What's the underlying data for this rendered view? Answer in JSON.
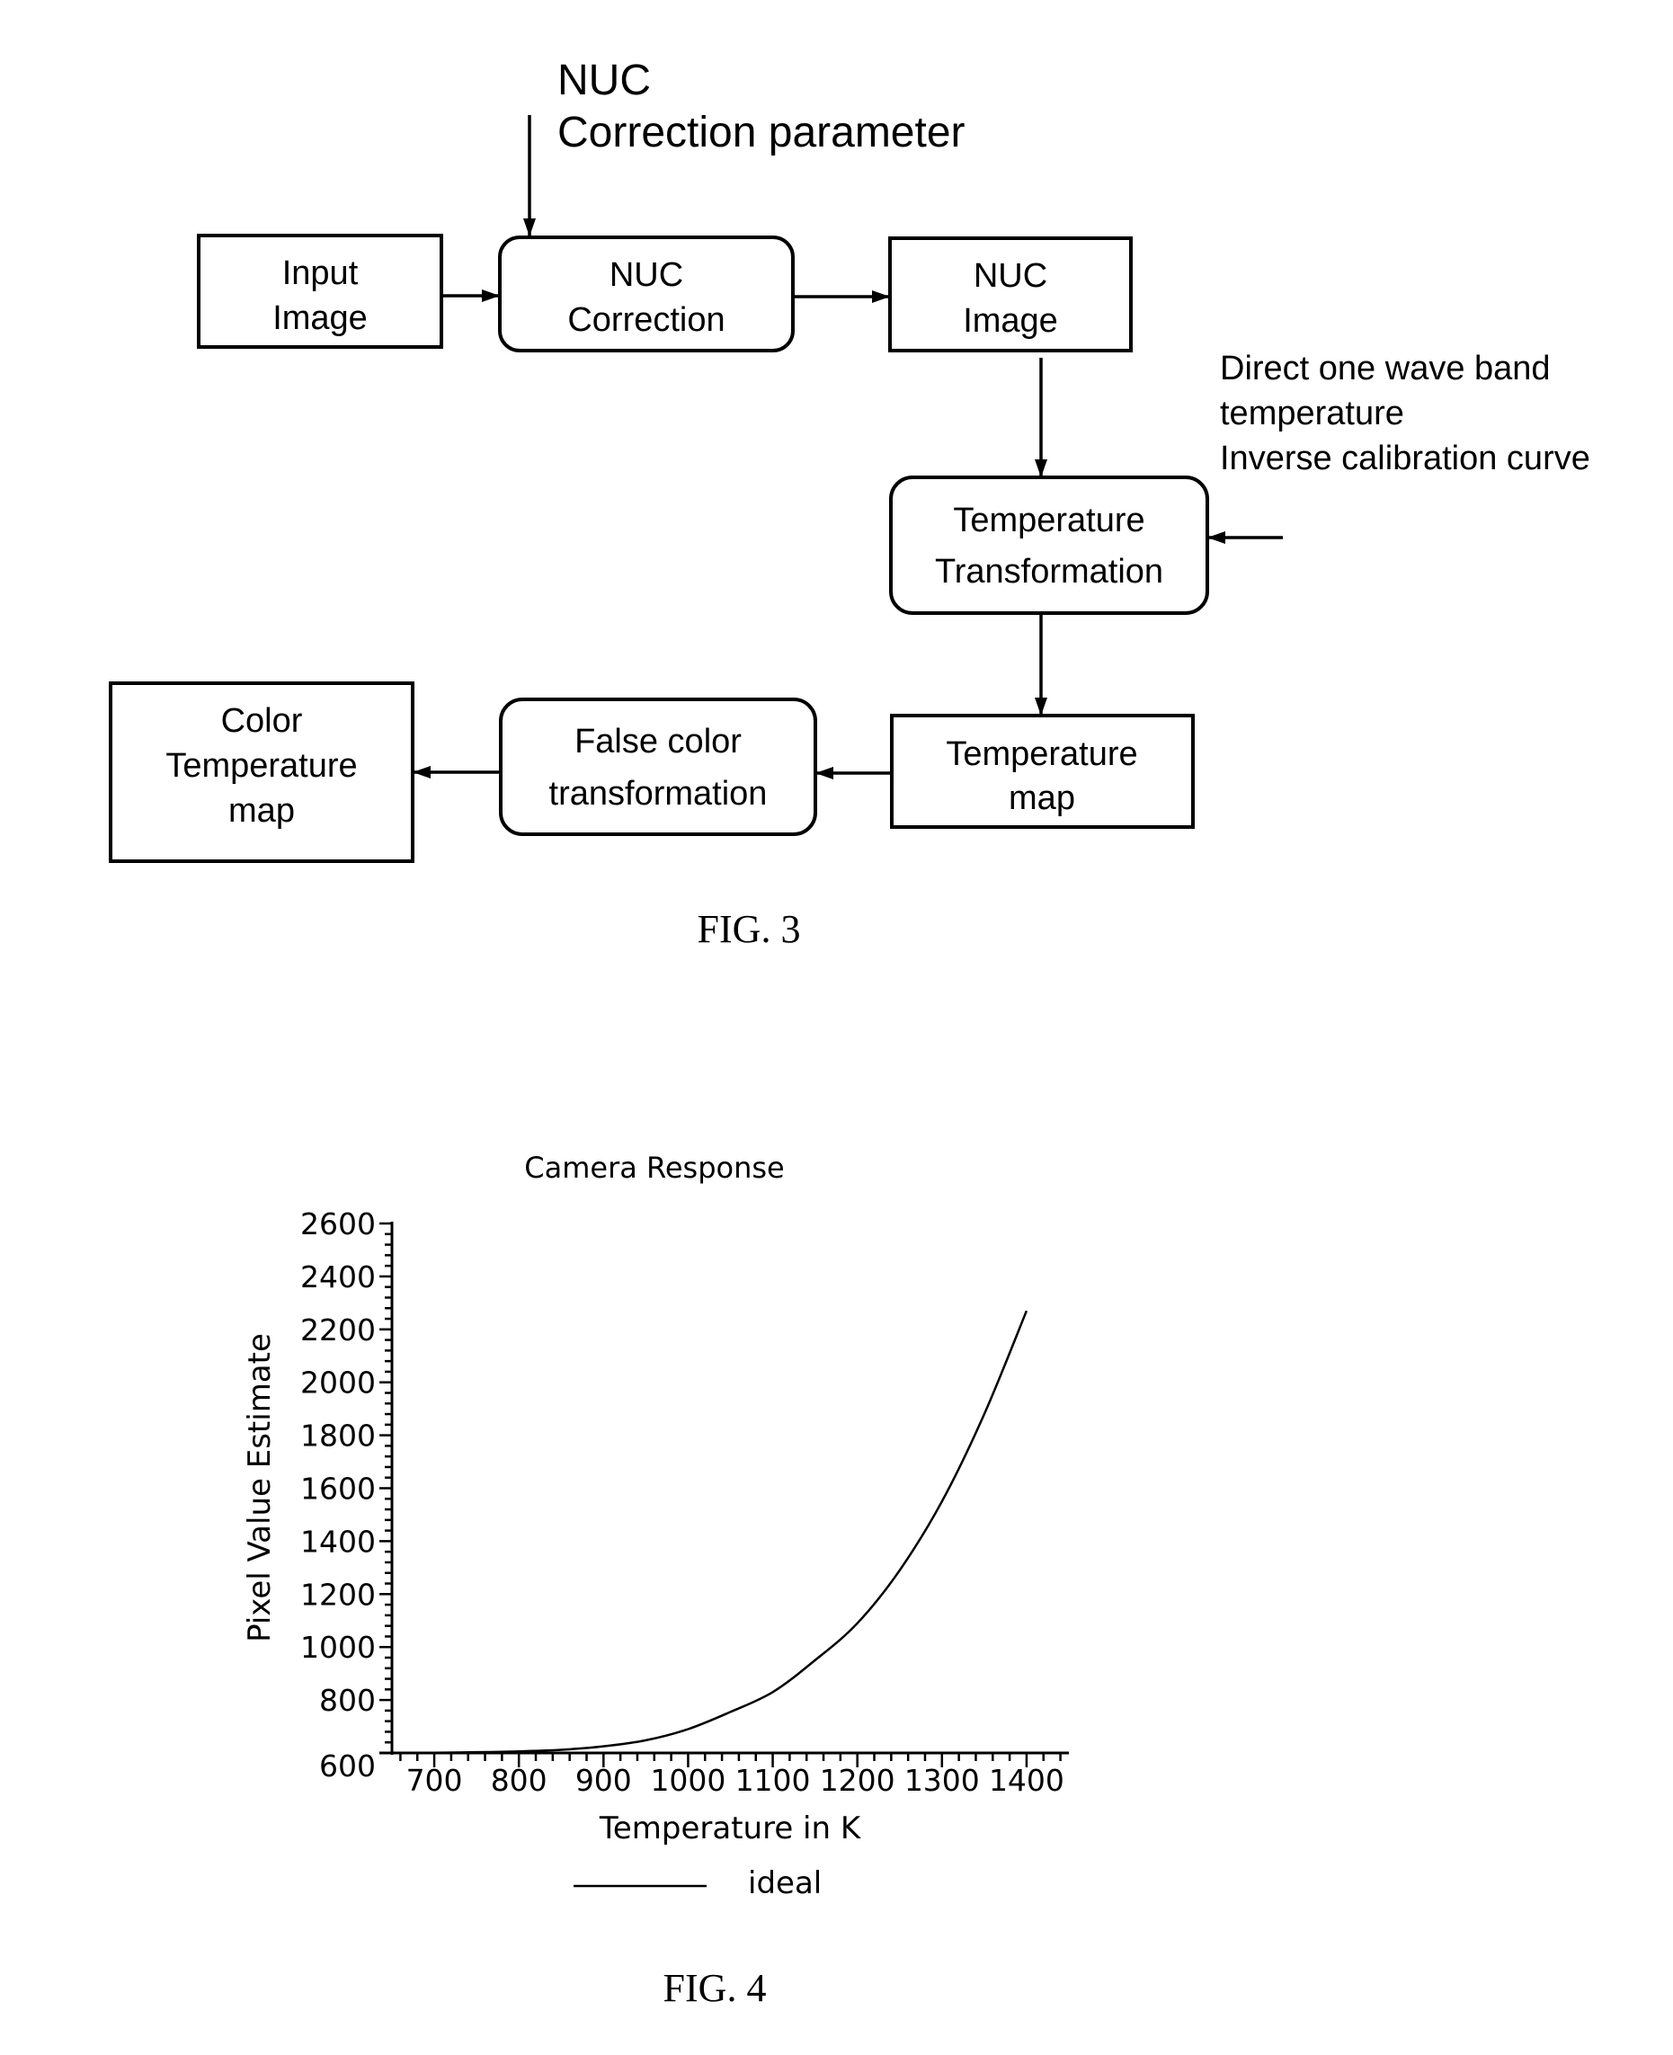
{
  "fig3": {
    "caption": "FIG. 3",
    "top_label": [
      "NUC",
      "Correction parameter"
    ],
    "side_label": [
      "Direct one wave band",
      "temperature",
      "Inverse calibration curve"
    ],
    "nodes": [
      {
        "id": "input_image",
        "shape": "rect",
        "lines": [
          "Input",
          "Image"
        ]
      },
      {
        "id": "nuc_correction",
        "shape": "rounded",
        "lines": [
          "NUC",
          "Correction"
        ]
      },
      {
        "id": "nuc_image",
        "shape": "rect",
        "lines": [
          "NUC",
          "Image"
        ]
      },
      {
        "id": "temperature_transformation",
        "shape": "rounded",
        "lines": [
          "Temperature",
          "Transformation"
        ]
      },
      {
        "id": "temperature_map",
        "shape": "rect",
        "lines": [
          "Temperature",
          "map"
        ]
      },
      {
        "id": "false_color_transformation",
        "shape": "rounded",
        "lines": [
          "False color",
          "transformation"
        ]
      },
      {
        "id": "color_temperature_map",
        "shape": "rect",
        "lines": [
          "Color",
          "Temperature",
          "map"
        ]
      }
    ],
    "edges": [
      {
        "from": "correction_parameter",
        "to": "nuc_correction"
      },
      {
        "from": "input_image",
        "to": "nuc_correction"
      },
      {
        "from": "nuc_correction",
        "to": "nuc_image"
      },
      {
        "from": "nuc_image",
        "to": "temperature_transformation"
      },
      {
        "from": "inverse_calibration_curve",
        "to": "temperature_transformation"
      },
      {
        "from": "temperature_transformation",
        "to": "temperature_map"
      },
      {
        "from": "temperature_map",
        "to": "false_color_transformation"
      },
      {
        "from": "false_color_transformation",
        "to": "color_temperature_map"
      }
    ]
  },
  "fig4": {
    "caption": "FIG. 4",
    "chart_data": {
      "type": "line",
      "title": "Camera Response",
      "xlabel": "Temperature in K",
      "ylabel": "Pixel Value Estimate",
      "xlim": [
        650,
        1450
      ],
      "ylim": [
        600,
        2600
      ],
      "x_ticks": [
        700,
        800,
        900,
        1000,
        1100,
        1200,
        1300,
        1400
      ],
      "x_tick_labels": [
        "700",
        "800",
        "900",
        "1000",
        "1100",
        "1200",
        "1300",
        "1400"
      ],
      "x_minor_step": 20,
      "y_ticks": [
        600,
        800,
        1000,
        1200,
        1400,
        1600,
        1800,
        2000,
        2200,
        2400,
        2600
      ],
      "y_tick_labels": [
        "600",
        "800",
        "1000",
        "1200",
        "1400",
        "1600",
        "1800",
        "2000",
        "2200",
        "2400",
        "2600"
      ],
      "y_minor_step": 40,
      "grid": false,
      "legend": {
        "position": "bottom",
        "entries": [
          "ideal"
        ]
      },
      "series": [
        {
          "name": "ideal",
          "x": [
            650,
            700,
            750,
            800,
            850,
            900,
            950,
            1000,
            1050,
            1100,
            1150,
            1200,
            1250,
            1300,
            1350,
            1400
          ],
          "y": [
            600,
            601,
            603,
            606,
            612,
            625,
            648,
            690,
            755,
            830,
            950,
            1090,
            1290,
            1550,
            1880,
            2270
          ]
        }
      ]
    }
  }
}
